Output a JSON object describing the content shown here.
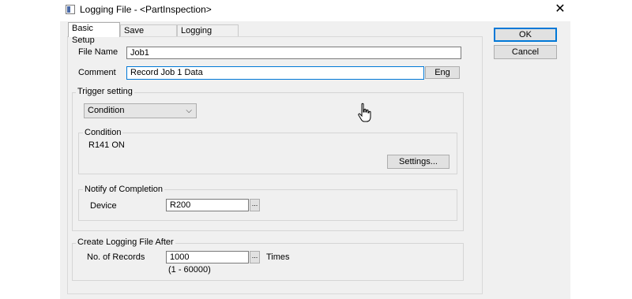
{
  "window": {
    "title": "Logging File - <PartInspection>"
  },
  "tabs": [
    "Basic Setup",
    "Save Setting",
    "Logging device"
  ],
  "buttons": {
    "ok": "OK",
    "cancel": "Cancel"
  },
  "basic_setup": {
    "file_name_label": "File Name",
    "file_name_value": "Job1",
    "comment_label": "Comment",
    "comment_value": "Record Job 1 Data",
    "eng_button": "Eng",
    "trigger_group": "Trigger setting",
    "trigger_mode": "Condition",
    "condition_group": "Condition",
    "condition_value": "R141 ON",
    "settings_button": "Settings...",
    "notify_group": "Notify of Completion",
    "device_label": "Device",
    "device_value": "R200",
    "create_group": "Create Logging File After",
    "records_label": "No. of Records",
    "records_value": "1000",
    "records_unit": "Times",
    "records_range": "(1 - 60000)",
    "browse_button": "..."
  }
}
